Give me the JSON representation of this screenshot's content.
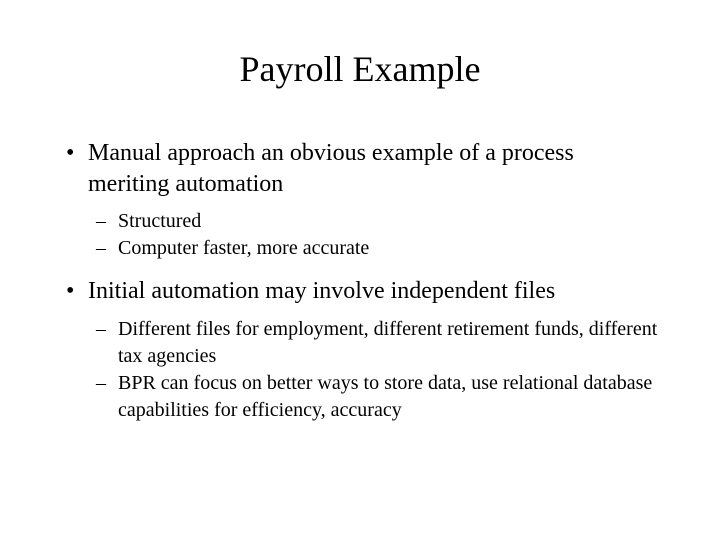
{
  "title": "Payroll Example",
  "bullets": [
    {
      "text": "Manual approach an obvious example of a process meriting automation",
      "children": [
        {
          "text": "Structured"
        },
        {
          "text": "Computer faster, more accurate"
        }
      ]
    },
    {
      "text": "Initial automation may involve independent files",
      "children": [
        {
          "text": "Different files for employment, different retirement funds, different tax agencies"
        },
        {
          "text": "BPR can focus on better ways to store data, use relational database capabilities for efficiency, accuracy"
        }
      ]
    }
  ]
}
